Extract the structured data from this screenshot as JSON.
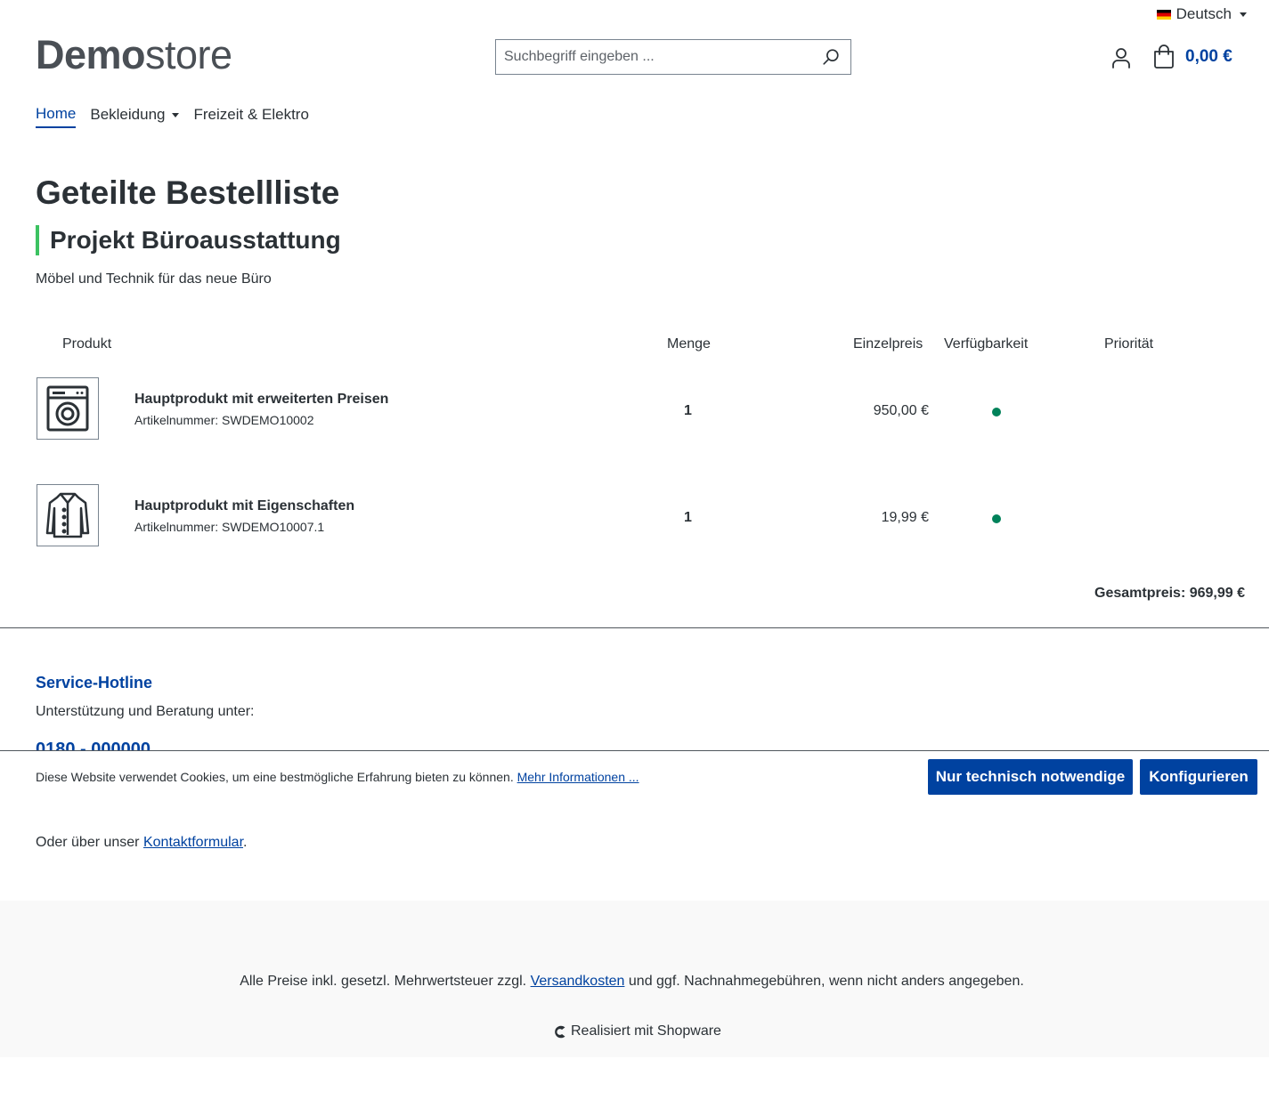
{
  "header": {
    "language": "Deutsch",
    "logo_bold": "Demo",
    "logo_light": "store",
    "search_placeholder": "Suchbegriff eingeben ...",
    "cart_total": "0,00 €"
  },
  "nav": {
    "items": [
      "Home",
      "Bekleidung",
      "Freizeit & Elektro"
    ]
  },
  "page": {
    "title": "Geteilte Bestellliste",
    "list_name": "Projekt Büroausstattung",
    "description": "Möbel und Technik für das neue Büro"
  },
  "table": {
    "headers": [
      "Produkt",
      "Menge",
      "Einzelpreis",
      "Verfügbarkeit",
      "Priorität"
    ],
    "rows": [
      {
        "name": "Hauptprodukt mit erweiterten Preisen",
        "number": "Artikelnummer: SWDEMO10002",
        "qty": "1",
        "price": "950,00 €",
        "icon": "washing-machine-icon"
      },
      {
        "name": "Hauptprodukt mit Eigenschaften",
        "number": "Artikelnummer: SWDEMO10007.1",
        "qty": "1",
        "price": "19,99 €",
        "icon": "jacket-icon"
      }
    ],
    "total": "Gesamtpreis: 969,99 €",
    "availability_color": "#00825a"
  },
  "service": {
    "title": "Service-Hotline",
    "text": "Unterstützung und Beratung unter:",
    "phone": "0180 - 000000",
    "contact_prefix": "Oder über unser",
    "contact_link": "Kontaktformular",
    "contact_suffix": "."
  },
  "cookie": {
    "text": "Diese Website verwendet Cookies, um eine bestmögliche Erfahrung bieten zu können.",
    "link": "Mehr Informationen ...",
    "btn_necessary": "Nur technisch notwendige",
    "btn_configure": "Konfigurieren"
  },
  "footer": {
    "vat_prefix": "Alle Preise inkl. gesetzl. Mehrwertsteuer zzgl.",
    "vat_link": "Versandkosten",
    "vat_suffix": "und ggf. Nachnahmegebühren, wenn nicht anders angegeben.",
    "powered": "Realisiert mit Shopware"
  },
  "colors": {
    "brand": "#0042a0",
    "accent_bar": "#3cc261",
    "text": "#2b3136"
  }
}
